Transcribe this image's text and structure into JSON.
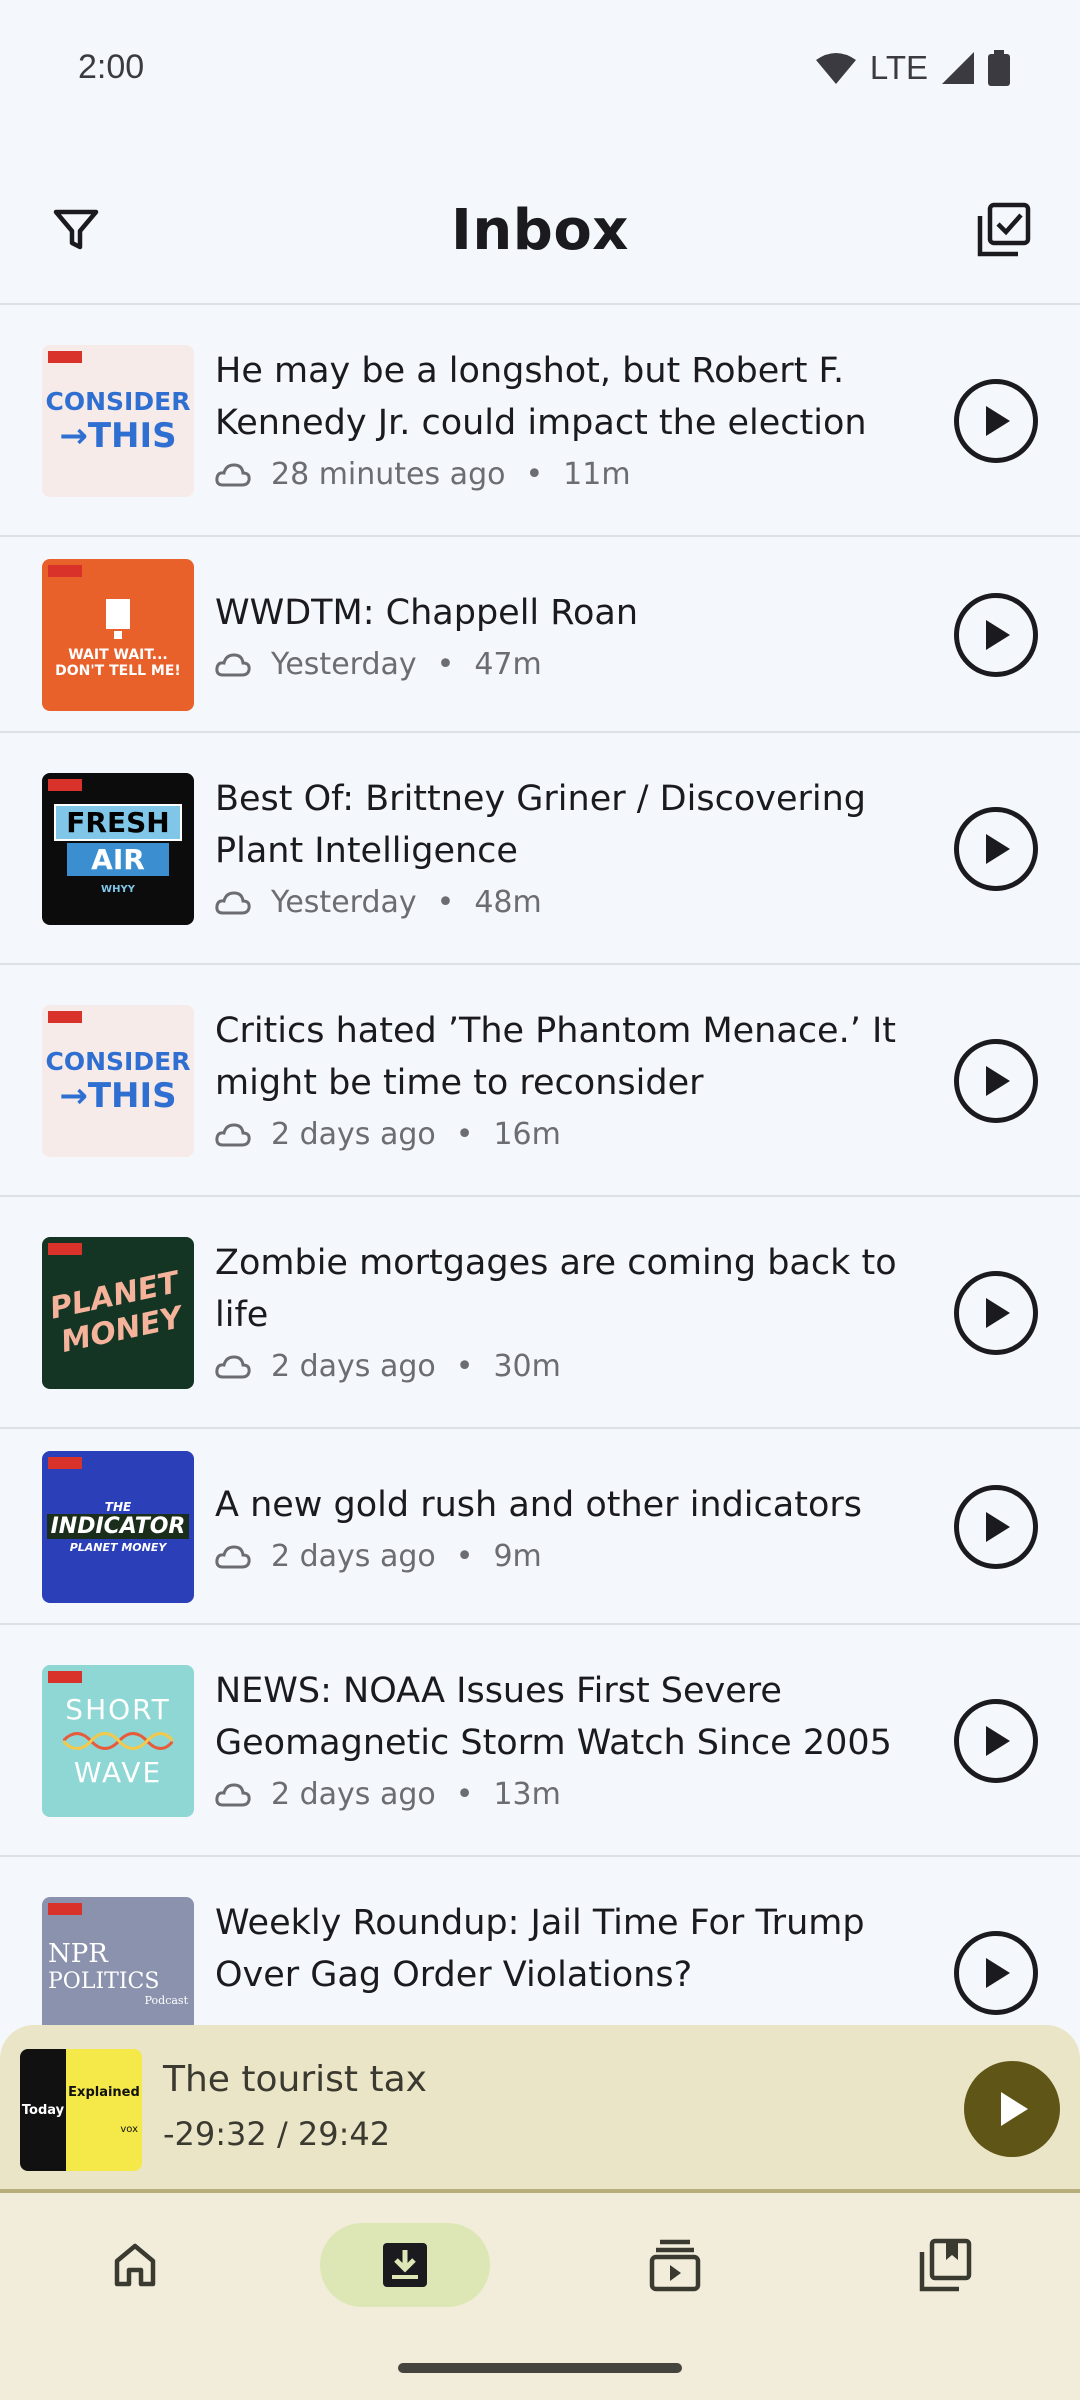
{
  "status_bar": {
    "time": "2:00",
    "network": "LTE"
  },
  "header": {
    "title": "Inbox",
    "filter_icon": "filter-icon",
    "select_icon": "select-all-icon"
  },
  "episodes": [
    {
      "title": "He may be a longshot, but Robert F. Kennedy Jr. could impact the election",
      "age": "28 minutes ago",
      "duration": "11m",
      "show": "consider-this"
    },
    {
      "title": "WWDTM: Chappell Roan",
      "age": "Yesterday",
      "duration": "47m",
      "show": "wait-wait"
    },
    {
      "title": "Best Of: Brittney Griner / Discovering Plant Intelligence",
      "age": "Yesterday",
      "duration": "48m",
      "show": "fresh-air"
    },
    {
      "title": "Critics hated ’The Phantom Menace.’ It might be time to reconsider",
      "age": "2 days ago",
      "duration": "16m",
      "show": "consider-this"
    },
    {
      "title": "Zombie mortgages are coming back to life",
      "age": "2 days ago",
      "duration": "30m",
      "show": "planet-money"
    },
    {
      "title": "A new gold rush and other indicators",
      "age": "2 days ago",
      "duration": "9m",
      "show": "the-indicator"
    },
    {
      "title": "NEWS: NOAA Issues First Severe Geomagnetic Storm Watch Since 2005",
      "age": "2 days ago",
      "duration": "13m",
      "show": "short-wave"
    },
    {
      "title": "Weekly Roundup: Jail Time For Trump Over Gag Order Violations?",
      "age": "",
      "duration": "",
      "show": "npr-politics"
    }
  ],
  "artwork_text": {
    "consider_line1": "CONSIDER",
    "consider_line2": "→THIS",
    "wait_line1": "WAIT WAIT...",
    "wait_line2": "DON'T TELL ME!",
    "fresh_line1": "FRESH",
    "fresh_line2": "AIR",
    "fresh_line3": "WHYY",
    "planet_line1": "PLANET",
    "planet_line2": "MONEY",
    "indicator_line1": "THE",
    "indicator_line2": "INDICATOR",
    "indicator_line3": "PLANET MONEY",
    "shortwave_line1": "SHORT",
    "shortwave_line2": "WAVE",
    "politics_line1": "NPR",
    "politics_line2": "POLITICS",
    "politics_line3": "Podcast",
    "today_line1": "Today",
    "today_line2": "Explained",
    "today_line3": "vox"
  },
  "mini_player": {
    "title": "The tourist tax",
    "time": "-29:32 / 29:42",
    "show": "today-explained"
  },
  "bottom_nav": [
    {
      "icon": "home-icon",
      "active": false
    },
    {
      "icon": "inbox-download-icon",
      "active": true
    },
    {
      "icon": "subscriptions-icon",
      "active": false
    },
    {
      "icon": "library-icon",
      "active": false
    }
  ],
  "colors": {
    "background": "#f4f7fb",
    "mini_player_bg": "#ebe5c8",
    "mini_play_bg": "#5f5516",
    "nav_bg": "#f2eddb",
    "nav_active": "#dde7b6"
  }
}
